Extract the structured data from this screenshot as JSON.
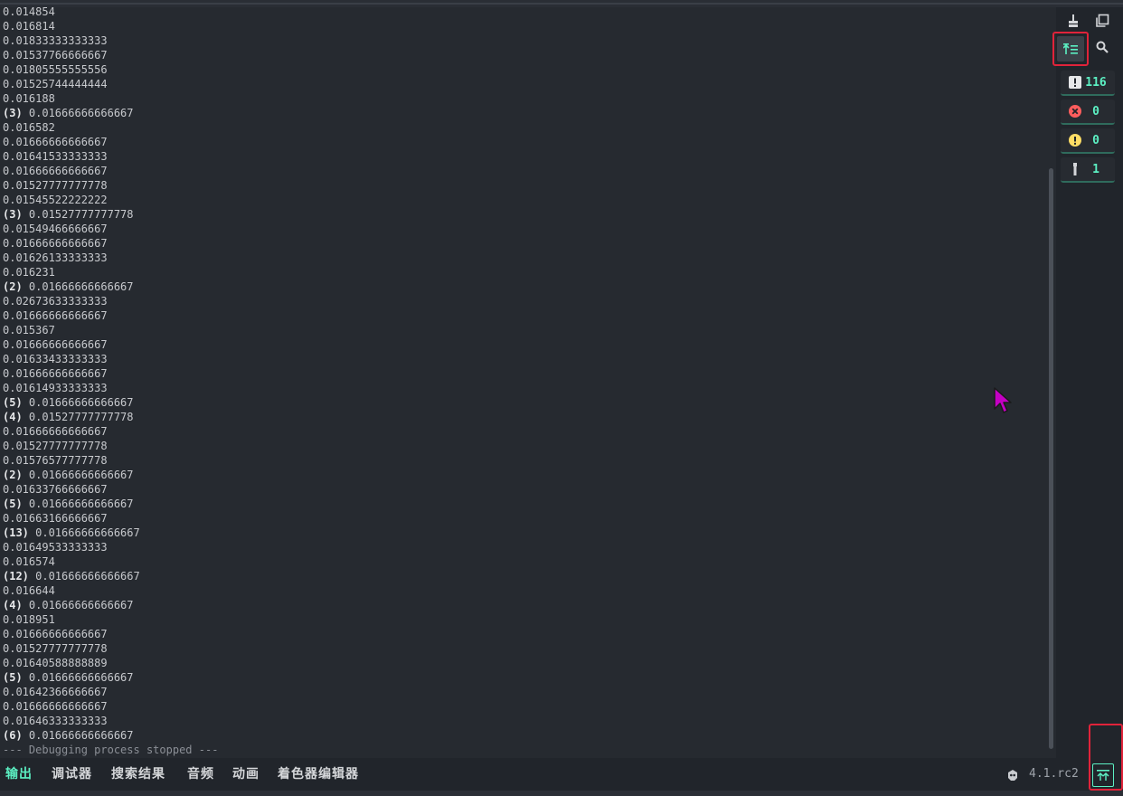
{
  "output": {
    "lines": [
      {
        "count": "",
        "text": "0.014854"
      },
      {
        "count": "",
        "text": "0.016814"
      },
      {
        "count": "",
        "text": "0.01833333333333"
      },
      {
        "count": "",
        "text": "0.01537766666667"
      },
      {
        "count": "",
        "text": "0.01805555555556"
      },
      {
        "count": "",
        "text": "0.01525744444444"
      },
      {
        "count": "",
        "text": "0.016188"
      },
      {
        "count": "(3)",
        "text": " 0.01666666666667"
      },
      {
        "count": "",
        "text": "0.016582"
      },
      {
        "count": "",
        "text": "0.01666666666667"
      },
      {
        "count": "",
        "text": "0.01641533333333"
      },
      {
        "count": "",
        "text": "0.01666666666667"
      },
      {
        "count": "",
        "text": "0.01527777777778"
      },
      {
        "count": "",
        "text": "0.01545522222222"
      },
      {
        "count": "(3)",
        "text": " 0.01527777777778"
      },
      {
        "count": "",
        "text": "0.01549466666667"
      },
      {
        "count": "",
        "text": "0.01666666666667"
      },
      {
        "count": "",
        "text": "0.01626133333333"
      },
      {
        "count": "",
        "text": "0.016231"
      },
      {
        "count": "(2)",
        "text": " 0.01666666666667"
      },
      {
        "count": "",
        "text": "0.02673633333333"
      },
      {
        "count": "",
        "text": "0.01666666666667"
      },
      {
        "count": "",
        "text": "0.015367"
      },
      {
        "count": "",
        "text": "0.01666666666667"
      },
      {
        "count": "",
        "text": "0.01633433333333"
      },
      {
        "count": "",
        "text": "0.01666666666667"
      },
      {
        "count": "",
        "text": "0.01614933333333"
      },
      {
        "count": "(5)",
        "text": " 0.01666666666667"
      },
      {
        "count": "(4)",
        "text": " 0.01527777777778"
      },
      {
        "count": "",
        "text": "0.01666666666667"
      },
      {
        "count": "",
        "text": "0.01527777777778"
      },
      {
        "count": "",
        "text": "0.01576577777778"
      },
      {
        "count": "(2)",
        "text": " 0.01666666666667"
      },
      {
        "count": "",
        "text": "0.01633766666667"
      },
      {
        "count": "(5)",
        "text": " 0.01666666666667"
      },
      {
        "count": "",
        "text": "0.01663166666667"
      },
      {
        "count": "(13)",
        "text": " 0.01666666666667"
      },
      {
        "count": "",
        "text": "0.01649533333333"
      },
      {
        "count": "",
        "text": "0.016574"
      },
      {
        "count": "(12)",
        "text": " 0.01666666666667"
      },
      {
        "count": "",
        "text": "0.016644"
      },
      {
        "count": "(4)",
        "text": " 0.01666666666667"
      },
      {
        "count": "",
        "text": "0.018951"
      },
      {
        "count": "",
        "text": "0.01666666666667"
      },
      {
        "count": "",
        "text": "0.01527777777778"
      },
      {
        "count": "",
        "text": "0.01640588888889"
      },
      {
        "count": "(5)",
        "text": " 0.01666666666667"
      },
      {
        "count": "",
        "text": "0.01642366666667"
      },
      {
        "count": "",
        "text": "0.01666666666667"
      },
      {
        "count": "",
        "text": "0.01646333333333"
      },
      {
        "count": "(6)",
        "text": " 0.01666666666667"
      }
    ],
    "stopped_message": "--- Debugging process stopped ---"
  },
  "filters": {
    "messages": "116",
    "errors": "0",
    "warnings": "0",
    "editor": "1"
  },
  "tabs": {
    "output": "输出",
    "debugger": "调试器",
    "search_results": "搜索结果",
    "audio": "音频",
    "animation": "动画",
    "shader_editor": "着色器编辑器"
  },
  "version": "4.1.rc2",
  "icons": {
    "clear": "broom-icon",
    "copy": "copy-icon",
    "collapse": "collapse-duplicates-icon",
    "search": "search-icon",
    "messages": "info-icon",
    "errors": "error-icon",
    "warnings": "warning-icon",
    "editor": "editor-icon",
    "engine": "godot-icon",
    "expand": "expand-panel-icon"
  },
  "colors": {
    "accent": "#5cf0c3",
    "highlight": "#e0233a",
    "error": "#ff5d5d",
    "warning": "#ffdd65"
  }
}
